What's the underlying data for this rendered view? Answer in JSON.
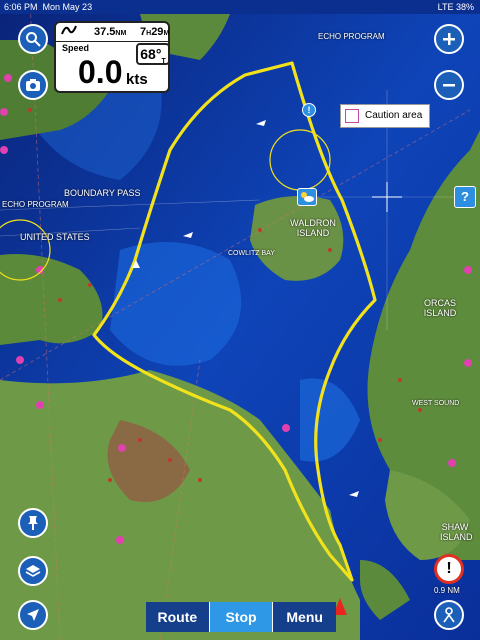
{
  "status_bar": {
    "time": "6:06 PM",
    "date": "Mon May 23",
    "network": "LTE",
    "battery": "38%"
  },
  "dashboard": {
    "distance": "37.5",
    "distance_unit": "NM",
    "eta_h": "7",
    "eta_h_unit": "H",
    "eta_m": "29",
    "eta_m_unit": "M",
    "speed_label": "Speed",
    "speed_value": "0.0",
    "speed_unit": "kts",
    "heading": "68°",
    "heading_ref": "T"
  },
  "caution_legend": {
    "label": "Caution area",
    "color": "#c04aa0"
  },
  "map_labels": {
    "echo_program_top": "ECHO PROGRAM",
    "boundary_pass": "BOUNDARY PASS",
    "echo_program_left": "ECHO PROGRAM",
    "united_states": "UNITED STATES",
    "waldron_island": "WALDRON ISLAND",
    "orcas_island": "ORCAS ISLAND",
    "shaw_island": "SHAW ISLAND",
    "west_sound": "WEST SOUND",
    "cowlitz_bay": "COWLITZ BAY"
  },
  "bottom_bar": {
    "route": "Route",
    "stop": "Stop",
    "menu": "Menu"
  },
  "scale": "0.9 NM",
  "colors": {
    "route": "#f2e21b",
    "ui_button": "#1b5fb8",
    "active_tab": "#2e97e6",
    "tab": "#153f8a",
    "deep_water": "#0a2c8c",
    "land": "#5c8a3c"
  },
  "icons": [
    "search-icon",
    "camera-icon",
    "zoom-in-icon",
    "zoom-out-icon",
    "help-icon",
    "weather-icon",
    "pin-icon",
    "layers-icon",
    "locate-arrow-icon",
    "person-icon",
    "alert-icon",
    "compass-icon"
  ]
}
